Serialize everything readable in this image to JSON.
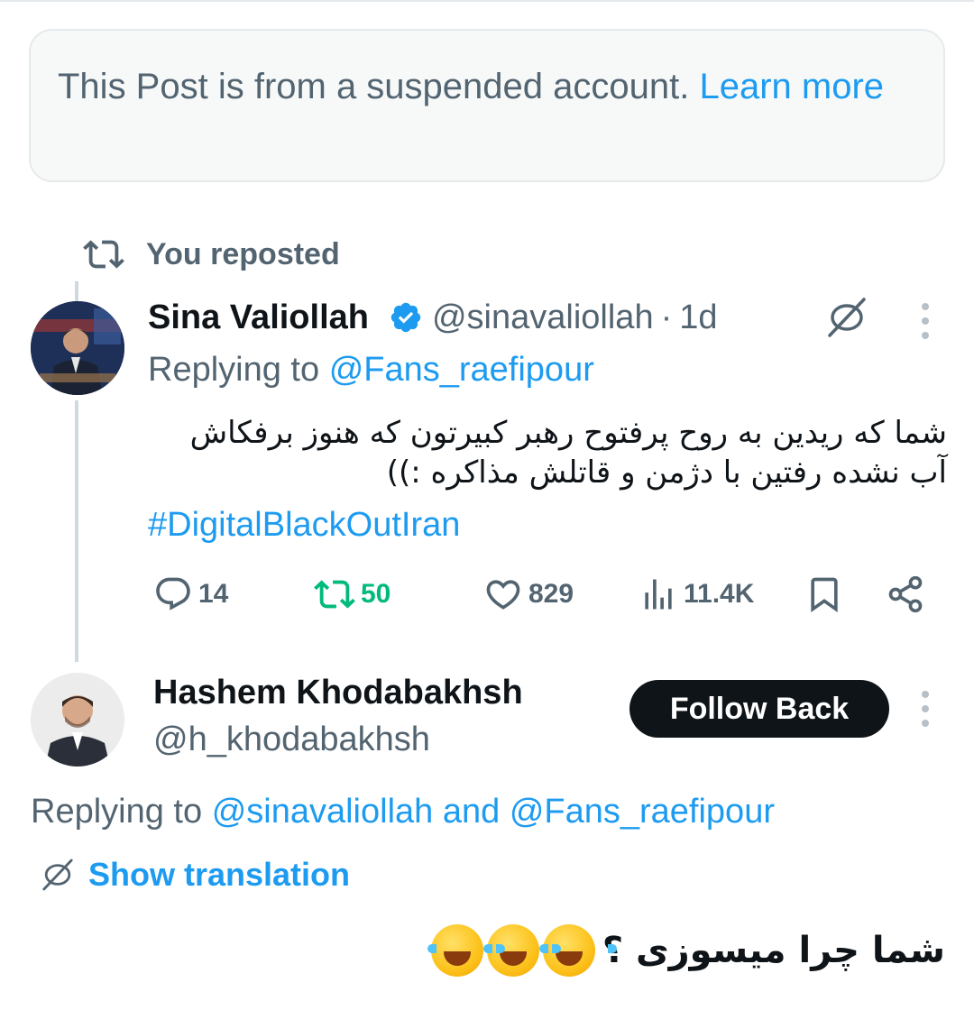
{
  "suspended_notice": {
    "text": "This Post is from a suspended account.",
    "link": "Learn more"
  },
  "repost_banner": {
    "text": "You reposted",
    "icon": "retweet-icon"
  },
  "tweet": {
    "author_name": "Sina Valiollah",
    "verified_icon": "verified-badge-icon",
    "handle": "@sinavaliollah",
    "separator": "·",
    "time": "1d",
    "replying_prefix": "Replying to",
    "replying_to": "@Fans_raefipour",
    "body": "شما که ریدین به روح پرفتوح رهبر کبیرتون که هنوز برفکاش آب نشده رفتین با دژمن و قاتلش مذاکره :))",
    "hashtag": "#DigitalBlackOutIran",
    "stats": {
      "replies": "14",
      "reposts": "50",
      "likes": "829",
      "views": "11.4K"
    },
    "repost_color": "#00ba7c"
  },
  "reply": {
    "author_name": "Hashem Khodabakhsh",
    "handle": "@h_khodabakhsh",
    "follow_label": "Follow Back",
    "replying_prefix": "Replying to",
    "replying_to_1": "@sinavaliollah",
    "and": "and",
    "replying_to_2": "@Fans_raefipour",
    "show_translation": "Show translation",
    "body": "شما چرا میسوزی ؟",
    "emoji_name": "tears-of-joy-emoji"
  },
  "colors": {
    "link": "#1d9bf0",
    "secondary_text": "#536471",
    "primary_text": "#0f1419",
    "notice_bg": "#f7f9f9"
  }
}
